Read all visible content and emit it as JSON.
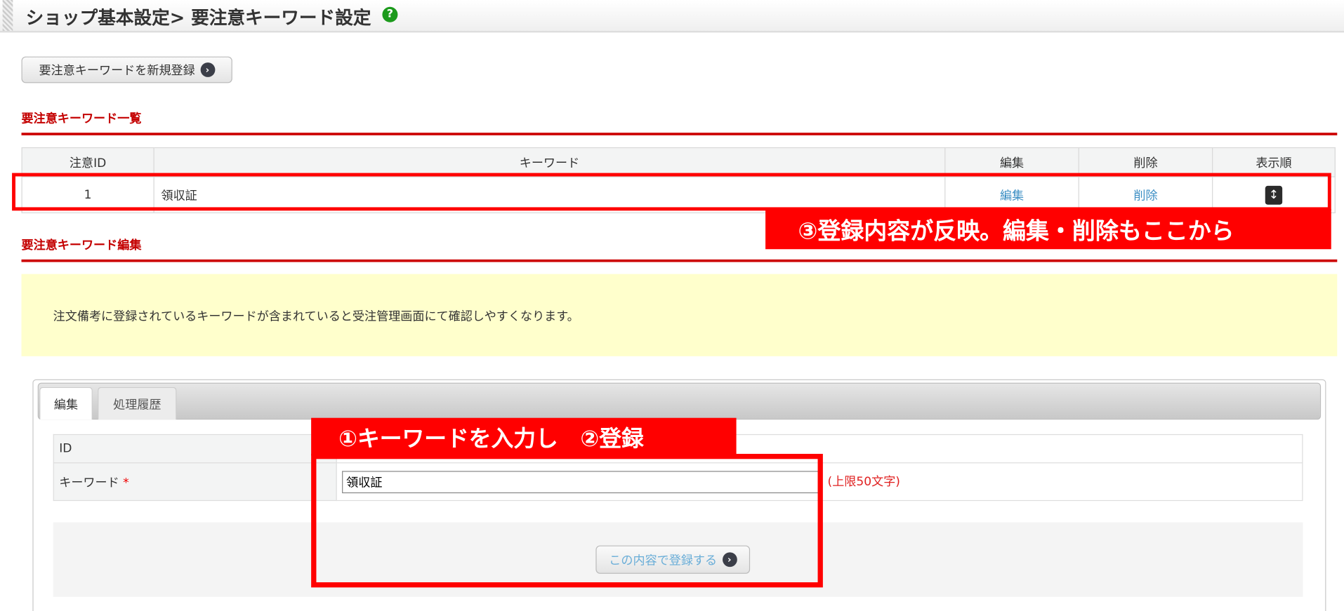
{
  "header": {
    "title": "ショップ基本設定> 要注意キーワード設定",
    "help_icon": "?"
  },
  "new_button": {
    "label": "要注意キーワードを新規登録"
  },
  "list_section": {
    "heading": "要注意キーワード一覧",
    "columns": [
      "注意ID",
      "キーワード",
      "編集",
      "削除",
      "表示順"
    ],
    "rows": [
      {
        "id": "1",
        "keyword": "領収証",
        "edit": "編集",
        "delete": "削除"
      }
    ]
  },
  "annotation3": "③登録内容が反映。編集・削除もここから",
  "edit_section": {
    "heading": "要注意キーワード編集",
    "notice": "注文備考に登録されているキーワードが含まれていると受注管理画面にて確認しやすくなります。",
    "tabs": [
      "編集",
      "処理履歴"
    ],
    "form": {
      "id_label": "ID",
      "keyword_label": "キーワード",
      "required_mark": "*",
      "keyword_value": "領収証",
      "limit_hint": "(上限50文字)"
    },
    "submit_label": "この内容で登録する"
  },
  "annotation12": "①キーワードを入力し　②登録",
  "colors": {
    "accent_red": "#cc0000",
    "annotation_red": "#ff0000",
    "link": "#3d8fc4",
    "notice_bg": "#ffffcc"
  }
}
